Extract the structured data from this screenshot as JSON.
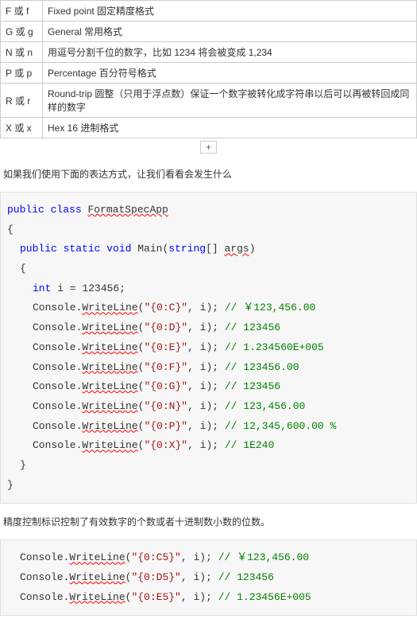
{
  "table": {
    "rows": [
      {
        "key": "F 或 f",
        "desc": "Fixed point  固定精度格式"
      },
      {
        "key": "G 或 g",
        "desc": "General  常用格式"
      },
      {
        "key": "N 或 n",
        "desc": "用逗号分割千位的数字，比如 1234 将会被变成 1,234"
      },
      {
        "key": "P 或 p",
        "desc": "Percentage  百分符号格式"
      },
      {
        "key": "R 或 r",
        "desc": "Round-trip    圆整（只用于浮点数）保证一个数字被转化成字符串以后可以再被转回成同样的数字"
      },
      {
        "key": "X 或 x",
        "desc": "Hex 16 进制格式"
      }
    ]
  },
  "plus_label": "+",
  "para1": "如果我们使用下面的表达方式，让我们看看会发生什么",
  "code1": {
    "class_decl_kw": "public class",
    "class_name": "FormatSpecApp",
    "main_sig_pub": "public static void",
    "main_name": "Main",
    "main_param_type": "string",
    "main_param_name": "args",
    "int_kw": "int",
    "int_decl": " i = 123456;",
    "lines": [
      {
        "call": "Console.",
        "method": "WriteLine",
        "args": "(\"{0:C}\", i);",
        "cmt": " // ￥123,456.00"
      },
      {
        "call": "Console.",
        "method": "WriteLine",
        "args": "(\"{0:D}\", i);",
        "cmt": " // 123456"
      },
      {
        "call": "Console.",
        "method": "WriteLine",
        "args": "(\"{0:E}\", i);",
        "cmt": " // 1.234560E+005"
      },
      {
        "call": "Console.",
        "method": "WriteLine",
        "args": "(\"{0:F}\", i);",
        "cmt": " // 123456.00"
      },
      {
        "call": "Console.",
        "method": "WriteLine",
        "args": "(\"{0:G}\", i);",
        "cmt": " // 123456"
      },
      {
        "call": "Console.",
        "method": "WriteLine",
        "args": "(\"{0:N}\", i);",
        "cmt": " // 123,456.00"
      },
      {
        "call": "Console.",
        "method": "WriteLine",
        "args": "(\"{0:P}\", i);",
        "cmt": " // 12,345,600.00 %"
      },
      {
        "call": "Console.",
        "method": "WriteLine",
        "args": "(\"{0:X}\", i);",
        "cmt": " // 1E240"
      }
    ]
  },
  "para2": "精度控制标识控制了有效数字的个数或者十进制数小数的位数。",
  "code2": {
    "lines": [
      {
        "call": "Console.",
        "method": "WriteLine",
        "args": "(\"{0:C5}\", i);",
        "cmt": " // ￥123,456.00"
      },
      {
        "call": "Console.",
        "method": "WriteLine",
        "args": "(\"{0:D5}\", i);",
        "cmt": " // 123456"
      },
      {
        "call": "Console.",
        "method": "WriteLine",
        "args": "(\"{0:E5}\", i);",
        "cmt": " // 1.23456E+005"
      }
    ]
  }
}
